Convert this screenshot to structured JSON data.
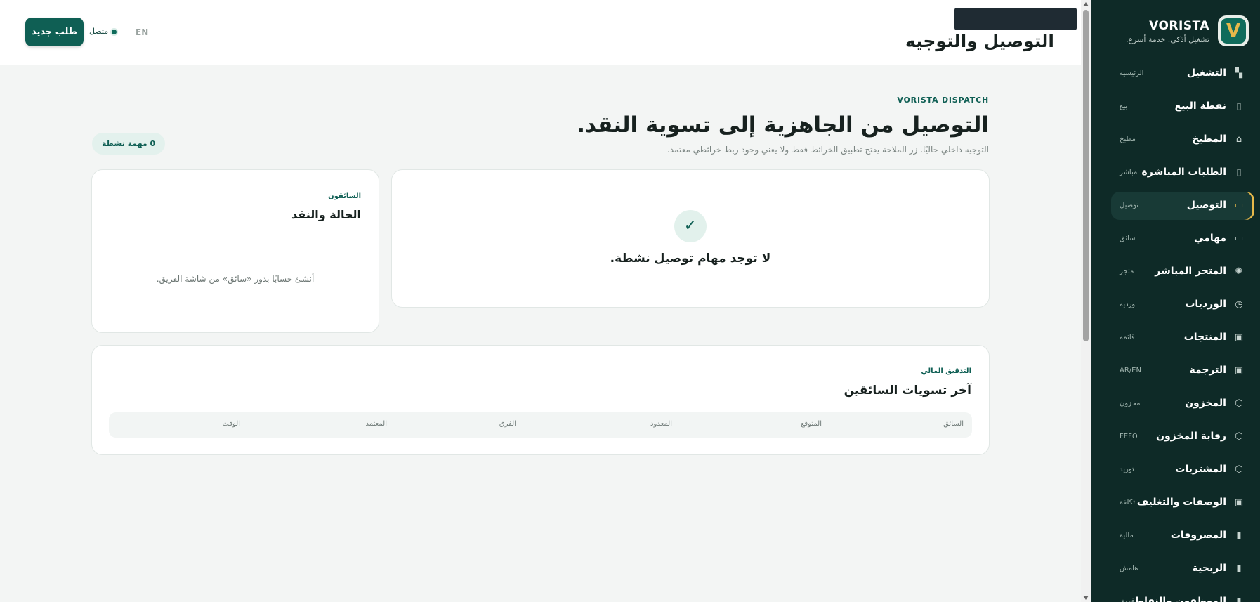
{
  "app": {
    "brand": "VORISTA",
    "tagline": "تشغيل أذكى. خدمة أسرع.",
    "logo_letter": "V"
  },
  "colors": {
    "sidebar_bg": "#0e2a27",
    "accent": "#0f5f54",
    "active_marker": "#e6b84a",
    "page_bg": "#f3f5f4"
  },
  "sidebar": {
    "items": [
      {
        "label": "التشغيل",
        "hint": "الرئيسية",
        "icon": "dashboard-icon",
        "glyph": "▚",
        "active": false
      },
      {
        "label": "نقطة البيع",
        "hint": "بيع",
        "icon": "pos-icon",
        "glyph": "▯",
        "active": false
      },
      {
        "label": "المطبخ",
        "hint": "مطبخ",
        "icon": "kitchen-icon",
        "glyph": "⌂",
        "active": false
      },
      {
        "label": "الطلبات المباشرة",
        "hint": "مباشر",
        "icon": "orders-icon",
        "glyph": "▯",
        "active": false
      },
      {
        "label": "التوصيل",
        "hint": "توصيل",
        "icon": "delivery-icon",
        "glyph": "▭",
        "active": true
      },
      {
        "label": "مهامي",
        "hint": "سائق",
        "icon": "tasks-icon",
        "glyph": "▭",
        "active": false
      },
      {
        "label": "المتجر المباشر",
        "hint": "متجر",
        "icon": "store-icon",
        "glyph": "✺",
        "active": false
      },
      {
        "label": "الورديات",
        "hint": "وردية",
        "icon": "clock-icon",
        "glyph": "◷",
        "active": false
      },
      {
        "label": "المنتجات",
        "hint": "قائمة",
        "icon": "products-icon",
        "glyph": "▣",
        "active": false
      },
      {
        "label": "الترجمة",
        "hint": "AR/EN",
        "icon": "translate-icon",
        "glyph": "▣",
        "active": false
      },
      {
        "label": "المخزون",
        "hint": "مخزون",
        "icon": "inventory-icon",
        "glyph": "⬡",
        "active": false
      },
      {
        "label": "رقابة المخزون",
        "hint": "FEFO",
        "icon": "stock-control-icon",
        "glyph": "⬡",
        "active": false
      },
      {
        "label": "المشتريات",
        "hint": "توريد",
        "icon": "purchases-icon",
        "glyph": "⬡",
        "active": false
      },
      {
        "label": "الوصفات والتغليف",
        "hint": "تكلفة",
        "icon": "recipes-icon",
        "glyph": "▣",
        "active": false
      },
      {
        "label": "المصروفات",
        "hint": "مالية",
        "icon": "expenses-icon",
        "glyph": "▮",
        "active": false
      },
      {
        "label": "الربحية",
        "hint": "هامش",
        "icon": "profit-icon",
        "glyph": "▮",
        "active": false
      },
      {
        "label": "الموظفون والنقاط",
        "hint": "فريق",
        "icon": "staff-icon",
        "glyph": "▮",
        "active": false
      }
    ]
  },
  "header": {
    "title": "التوصيل والتوجيه",
    "new_order_label": "طلب جديد",
    "status_label": "متصل",
    "lang_label": "EN"
  },
  "hero": {
    "eyebrow": "VORISTA DISPATCH",
    "title": "التوصيل من الجاهزية إلى تسوية النقد.",
    "subtitle": "التوجيه داخلي حاليًا. زر الملاحة يفتح تطبيق الخرائط فقط ولا يعني وجود ربط خرائطي معتمد.",
    "active_badge": "0 مهمة نشطة"
  },
  "empty_state": {
    "icon": "check-icon",
    "glyph": "✓",
    "text": "لا توجد مهام توصيل نشطة."
  },
  "drivers_card": {
    "eyebrow": "السائقون",
    "title": "الحالة والنقد",
    "note": "أنشئ حسابًا بدور «سائق» من شاشة الفريق."
  },
  "audit_card": {
    "eyebrow": "التدقيق المالي",
    "title": "آخر تسويات السائقين",
    "columns": [
      "السائق",
      "المتوقع",
      "المعدود",
      "الفرق",
      "المعتمد",
      "الوقت"
    ]
  }
}
